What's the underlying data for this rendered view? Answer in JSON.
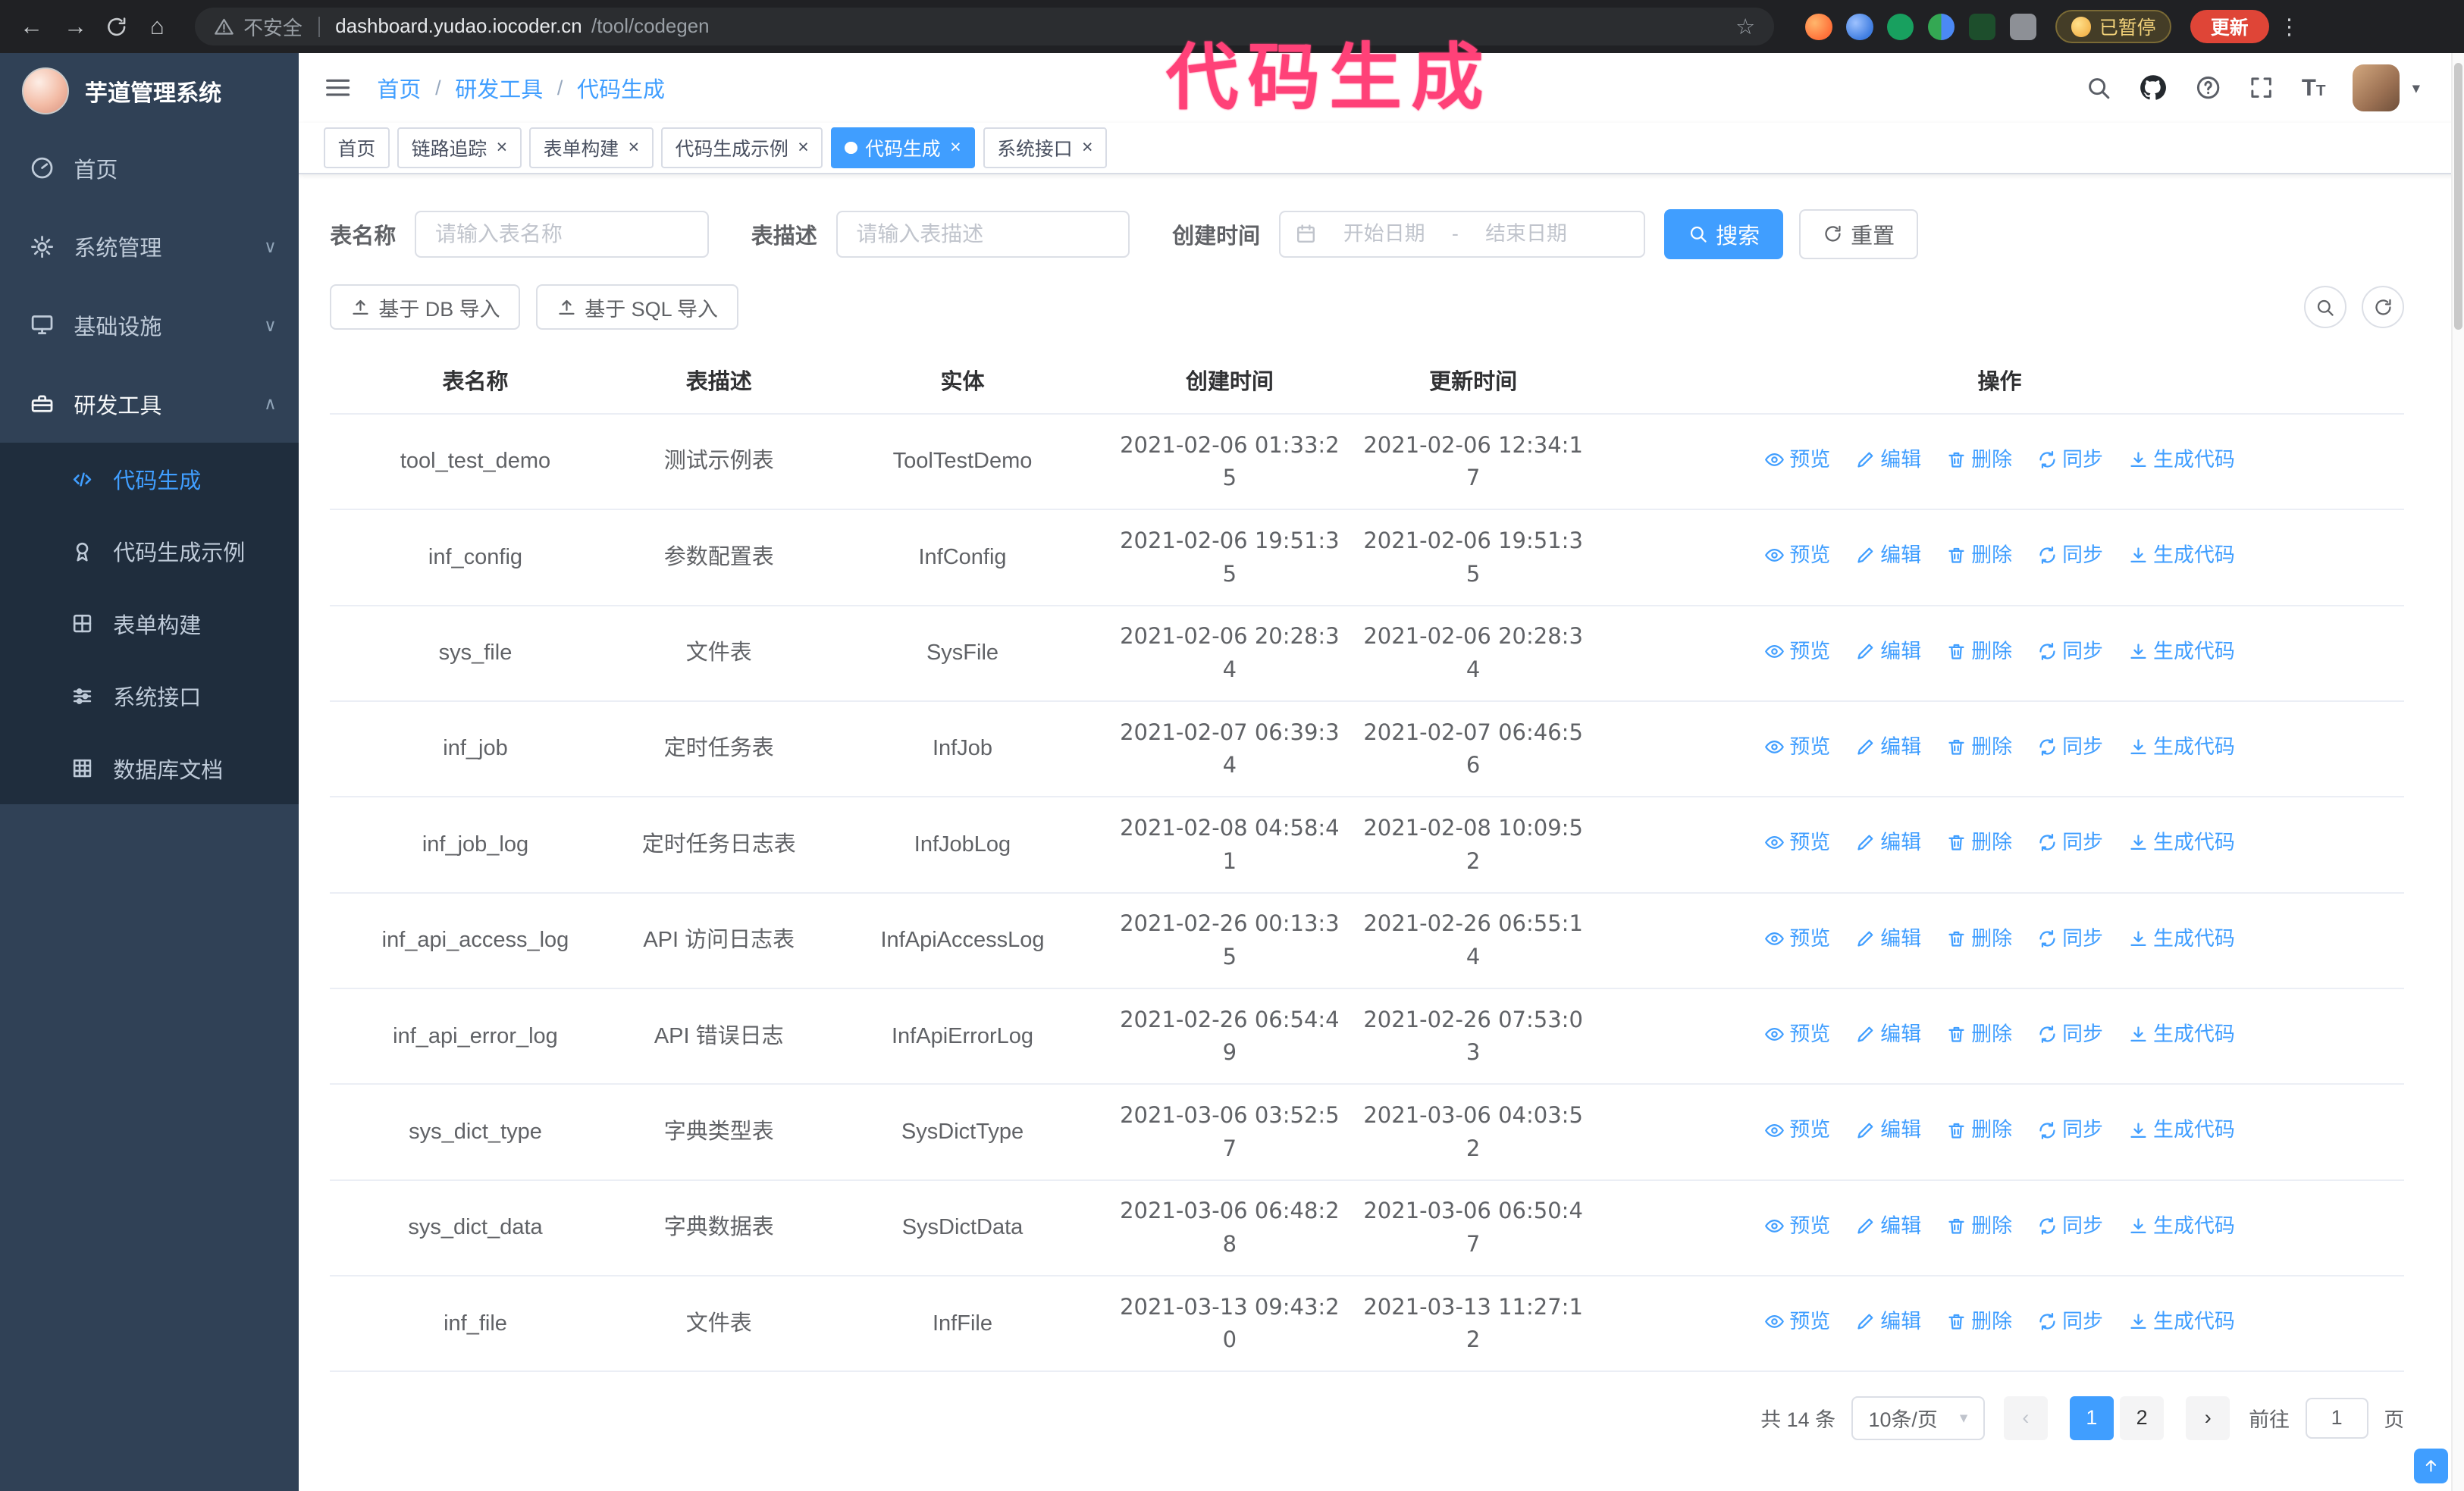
{
  "annotation": {
    "text": "代码生成",
    "color": "#ff4178"
  },
  "browser": {
    "security_label": "不安全",
    "url_host": "dashboard.yudao.iocoder.cn",
    "url_path": "/tool/codegen",
    "paused_badge": "已暂停",
    "update_button": "更新"
  },
  "glyphs": {
    "back": "←",
    "forward": "→",
    "home": "⌂",
    "star": "☆",
    "dots": "⋮",
    "slash": "/",
    "close": "×",
    "prev": "‹",
    "next": "›",
    "caret": "▾",
    "chevron_down": "∨",
    "chevron_up": "∧",
    "t_large": "T",
    "t_small": "T"
  },
  "sidebar": {
    "logo_title": "芋道管理系统",
    "items": [
      {
        "key": "home",
        "label": "首页",
        "icon": "gauge"
      },
      {
        "key": "system",
        "label": "系统管理",
        "icon": "gear",
        "chevron": "down"
      },
      {
        "key": "infra",
        "label": "基础设施",
        "icon": "monitor",
        "chevron": "down"
      },
      {
        "key": "dev-tools",
        "label": "研发工具",
        "icon": "toolbox",
        "chevron": "up",
        "active_section": true
      }
    ],
    "subitems": [
      {
        "key": "codegen",
        "label": "代码生成",
        "icon": "code",
        "active": true
      },
      {
        "key": "codegen-example",
        "label": "代码生成示例",
        "icon": "medal"
      },
      {
        "key": "form-builder",
        "label": "表单构建",
        "icon": "form"
      },
      {
        "key": "system-api",
        "label": "系统接口",
        "icon": "sliders"
      },
      {
        "key": "db-doc",
        "label": "数据库文档",
        "icon": "grid"
      }
    ]
  },
  "navbar": {
    "breadcrumb": [
      "首页",
      "研发工具",
      "代码生成"
    ]
  },
  "tabs": [
    {
      "label": "首页",
      "closable": false
    },
    {
      "label": "链路追踪",
      "closable": true
    },
    {
      "label": "表单构建",
      "closable": true
    },
    {
      "label": "代码生成示例",
      "closable": true
    },
    {
      "label": "代码生成",
      "closable": true,
      "active": true
    },
    {
      "label": "系统接口",
      "closable": true
    }
  ],
  "filters": {
    "table_name_label": "表名称",
    "table_name_placeholder": "请输入表名称",
    "table_desc_label": "表描述",
    "table_desc_placeholder": "请输入表描述",
    "create_time_label": "创建时间",
    "date_start_placeholder": "开始日期",
    "date_separator": "-",
    "date_end_placeholder": "结束日期",
    "search_button": "搜索",
    "reset_button": "重置"
  },
  "toolbar": {
    "import_db": "基于 DB 导入",
    "import_sql": "基于 SQL 导入"
  },
  "table": {
    "columns": [
      "表名称",
      "表描述",
      "实体",
      "创建时间",
      "更新时间",
      "操作"
    ],
    "ops": [
      "预览",
      "编辑",
      "删除",
      "同步",
      "生成代码"
    ],
    "rows": [
      {
        "name": "tool_test_demo",
        "desc": "测试示例表",
        "entity": "ToolTestDemo",
        "created": "2021-02-06 01:33:25",
        "updated": "2021-02-06 12:34:17"
      },
      {
        "name": "inf_config",
        "desc": "参数配置表",
        "entity": "InfConfig",
        "created": "2021-02-06 19:51:35",
        "updated": "2021-02-06 19:51:35"
      },
      {
        "name": "sys_file",
        "desc": "文件表",
        "entity": "SysFile",
        "created": "2021-02-06 20:28:34",
        "updated": "2021-02-06 20:28:34"
      },
      {
        "name": "inf_job",
        "desc": "定时任务表",
        "entity": "InfJob",
        "created": "2021-02-07 06:39:34",
        "updated": "2021-02-07 06:46:56"
      },
      {
        "name": "inf_job_log",
        "desc": "定时任务日志表",
        "entity": "InfJobLog",
        "created": "2021-02-08 04:58:41",
        "updated": "2021-02-08 10:09:52"
      },
      {
        "name": "inf_api_access_log",
        "desc": "API 访问日志表",
        "entity": "InfApiAccessLog",
        "created": "2021-02-26 00:13:35",
        "updated": "2021-02-26 06:55:14"
      },
      {
        "name": "inf_api_error_log",
        "desc": "API 错误日志",
        "entity": "InfApiErrorLog",
        "created": "2021-02-26 06:54:49",
        "updated": "2021-02-26 07:53:03"
      },
      {
        "name": "sys_dict_type",
        "desc": "字典类型表",
        "entity": "SysDictType",
        "created": "2021-03-06 03:52:57",
        "updated": "2021-03-06 04:03:52"
      },
      {
        "name": "sys_dict_data",
        "desc": "字典数据表",
        "entity": "SysDictData",
        "created": "2021-03-06 06:48:28",
        "updated": "2021-03-06 06:50:47"
      },
      {
        "name": "inf_file",
        "desc": "文件表",
        "entity": "InfFile",
        "created": "2021-03-13 09:43:20",
        "updated": "2021-03-13 11:27:12"
      }
    ]
  },
  "pagination": {
    "total_text": "共 14 条",
    "page_size": "10条/页",
    "pages": [
      "1",
      "2"
    ],
    "active_page": "1",
    "goto_prefix": "前往",
    "goto_value": "1",
    "goto_suffix": "页"
  },
  "colors": {
    "accent": "#409eff",
    "sidebar_bg": "#304156",
    "submenu_bg": "#1f2d3d",
    "annotation": "#ff4178",
    "update_button": "#df4537"
  }
}
